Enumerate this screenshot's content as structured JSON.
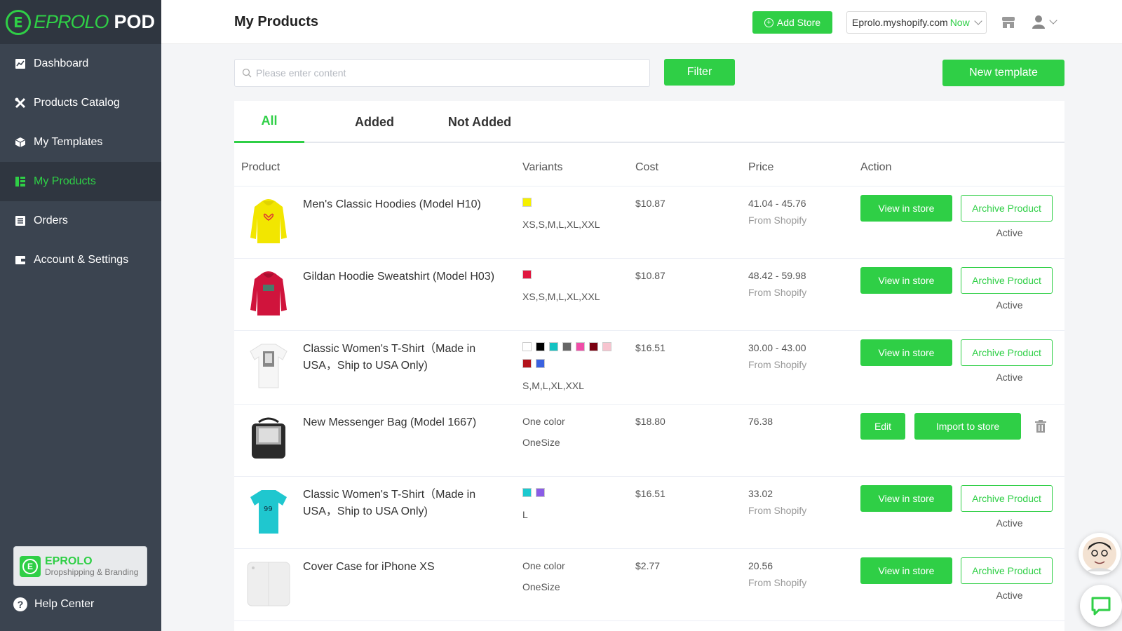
{
  "brand": {
    "logo_text": "EPROLO",
    "logo_suffix": "POD",
    "accent": "#2fcf46",
    "sidebar_bg": "#3b4450"
  },
  "sidebar": {
    "items": [
      {
        "label": "Dashboard",
        "icon": "chart-icon"
      },
      {
        "label": "Products Catalog",
        "icon": "tools-icon"
      },
      {
        "label": "My Templates",
        "icon": "box-icon"
      },
      {
        "label": "My Products",
        "icon": "grid-icon",
        "active": true
      },
      {
        "label": "Orders",
        "icon": "list-icon"
      },
      {
        "label": "Account & Settings",
        "icon": "wallet-icon"
      }
    ],
    "brand_card": {
      "name": "EPROLO",
      "tagline": "Dropshipping & Branding"
    },
    "help": "Help Center"
  },
  "header": {
    "title": "My Products",
    "add_store": "Add Store",
    "store": "Eprolo.myshopify.com",
    "store_status": "Now"
  },
  "toolbar": {
    "search_placeholder": "Please enter content",
    "filter": "Filter",
    "new_template": "New template"
  },
  "tabs": [
    "All",
    "Added",
    "Not Added"
  ],
  "table": {
    "headers": {
      "product": "Product",
      "variants": "Variants",
      "cost": "Cost",
      "price": "Price",
      "action": "Action"
    },
    "rows": [
      {
        "name": "Men's Classic Hoodies (Model H10)",
        "colors": [
          "#f5f000"
        ],
        "sizes": "XS,S,M,L,XL,XXL",
        "cost": "$10.87",
        "price": "41.04 - 45.76",
        "price_source": "From Shopify",
        "view": "View in store",
        "archive": "Archive Product",
        "status": "Active",
        "thumb": "hoodie-yellow"
      },
      {
        "name": "Gildan Hoodie Sweatshirt (Model H03)",
        "colors": [
          "#e0173f"
        ],
        "sizes": "XS,S,M,L,XL,XXL",
        "cost": "$10.87",
        "price": "48.42 - 59.98",
        "price_source": "From Shopify",
        "view": "View in store",
        "archive": "Archive Product",
        "status": "Active",
        "thumb": "hoodie-red"
      },
      {
        "name": "Classic Women's T-Shirt（Made in USA，Ship to USA Only)",
        "colors": [
          "#ffffff",
          "#000000",
          "#13c2c2",
          "#666666",
          "#f04da8",
          "#7a0010",
          "#f7c4cf",
          "#b3131b",
          "#3a62e0"
        ],
        "sizes": "S,M,L,XL,XXL",
        "cost": "$16.51",
        "price": "30.00 - 43.00",
        "price_source": "From Shopify",
        "view": "View in store",
        "archive": "Archive Product",
        "status": "Active",
        "thumb": "tshirt-white"
      },
      {
        "name": "New Messenger Bag (Model 1667)",
        "variant_text": "One color",
        "sizes": "OneSize",
        "cost": "$18.80",
        "price": "76.38",
        "edit": "Edit",
        "import": "Import to store",
        "thumb": "messenger-bag"
      },
      {
        "name": "Classic Women's T-Shirt（Made in USA，Ship to USA Only)",
        "colors": [
          "#1cc9cf",
          "#8a5ce6"
        ],
        "sizes": "L",
        "cost": "$16.51",
        "price": "33.02",
        "price_source": "From Shopify",
        "view": "View in store",
        "archive": "Archive Product",
        "status": "Active",
        "thumb": "tshirt-cyan"
      },
      {
        "name": "Cover Case for iPhone XS",
        "variant_text": "One color",
        "sizes": "OneSize",
        "cost": "$2.77",
        "price": "20.56",
        "price_source": "From Shopify",
        "view": "View in store",
        "archive": "Archive Product",
        "status": "Active",
        "thumb": "phone-case"
      }
    ]
  }
}
